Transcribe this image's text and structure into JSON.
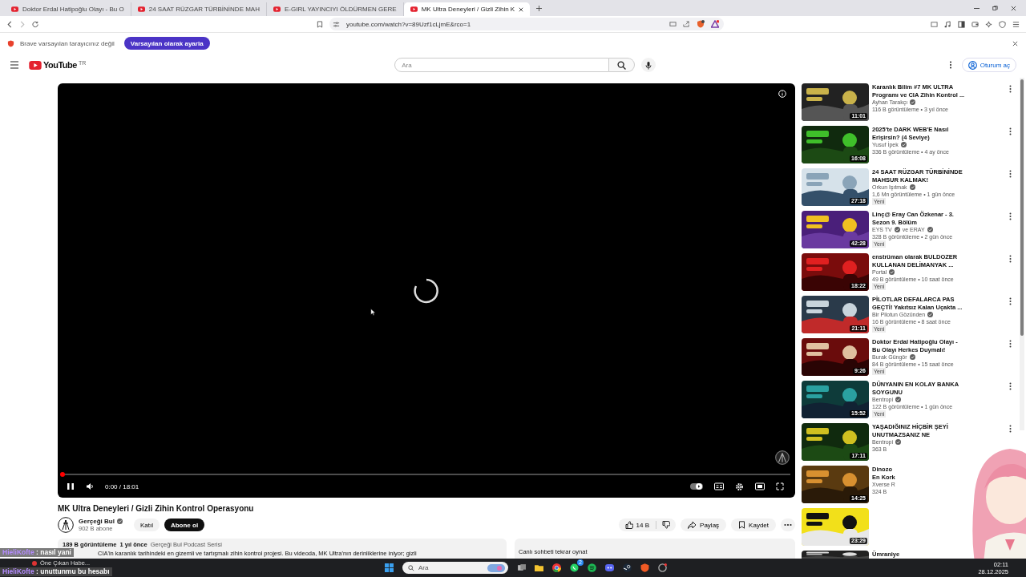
{
  "browser": {
    "tabs": [
      {
        "title": "Doktor Erdal Hatipoğlu Olayı - Bu O",
        "selected": false
      },
      {
        "title": "24 SAAT RÜZGAR TÜRBİNİNDE MAH",
        "selected": false
      },
      {
        "title": "E-GIRL YAYINCIYI ÖLDÜRMEN GERE",
        "selected": false
      },
      {
        "title": "MK Ultra Deneyleri / Gizli Zihin K",
        "selected": true
      }
    ],
    "address": "youtube.com/watch?v=89Uzf1cLjmE&rco=1",
    "infobar": {
      "text": "Brave varsayılan tarayıcınız değil",
      "button": "Varsayılan olarak ayarla"
    }
  },
  "header": {
    "logo": "YouTube",
    "region": "TR",
    "search_placeholder": "Ara",
    "sign_in": "Oturum aç"
  },
  "player": {
    "time": "0:00 / 18:01",
    "level": 0,
    "playing": true
  },
  "video": {
    "title": "MK Ultra Deneyleri / Gizli Zihin Kontrol Operasyonu",
    "channel": "Gerçeği Bul",
    "subscribers": "902 B abone",
    "join": "Katıl",
    "subscribe": "Abone ol",
    "likes": "14 B",
    "share": "Paylaş",
    "save": "Kaydet",
    "views": "189 B görüntüleme",
    "age": "1 yıl önce",
    "playlist": "Gerçeği Bul Podcast Serisi",
    "description": "CIA'in karanlık tarihindeki en gizemli ve tartışmalı zihin kontrol projesi. Bu videoda, MK Ultra'nın derinliklerine iniyor; gizli"
  },
  "chat_replay": {
    "title": "Canlı sohbeti tekrar oynat"
  },
  "recommendations": [
    {
      "title": "Karanlık Bilim #7 MK ULTRA\nProgramı ve CIA Zihin Kontrol ...",
      "channel": "Ayhan Tarakçı",
      "verified": true,
      "meta": "116 B görüntüleme • 3 yıl önce",
      "duration": "11:01"
    },
    {
      "title": "2025'te DARK WEB'E Nasıl\nErişirsin? (4 Seviye)",
      "channel": "Yusuf İpek",
      "verified": true,
      "meta": "336 B görüntüleme • 4 ay önce",
      "duration": "16:08"
    },
    {
      "title": "24 SAAT RÜZGAR TÜRBİNİNDE\nMAHSUR KALMAK!",
      "channel": "Orkun Işıtmak",
      "verified": true,
      "meta": "1,6 Mn görüntüleme • 1 gün önce",
      "duration": "27:18",
      "badge": "Yeni"
    },
    {
      "title": "Linç@ Eray Can Özkenar - 3.\nSezon 9. Bölüm",
      "channel": "EYS TV",
      "verified": true,
      "co_channel": "ve ERAY",
      "meta": "328 B görüntüleme • 2 gün önce",
      "duration": "42:28",
      "badge": "Yeni"
    },
    {
      "title": "enstrüman olarak BULDOZER\nKULLANAN DELİMANYAK ...",
      "channel": "Portal",
      "verified": true,
      "meta": "49 B görüntüleme • 10 saat önce",
      "duration": "18:22",
      "badge": "Yeni"
    },
    {
      "title": "PİLOTLAR DEFALARCA PAS\nGEÇTİ! Yakıtsız Kalan Uçakta ...",
      "channel": "Bir Pilotun Gözünden",
      "verified": true,
      "meta": "16 B görüntüleme • 8 saat önce",
      "duration": "21:11",
      "badge": "Yeni"
    },
    {
      "title": "Doktor Erdal Hatipoğlu Olayı -\nBu Olayı Herkes Duymalı!",
      "channel": "Burak Güngör",
      "verified": true,
      "meta": "84 B görüntüleme • 15 saat önce",
      "duration": "9:26",
      "badge": "Yeni"
    },
    {
      "title": "DÜNYANIN EN KOLAY BANKA\nSOYGUNU",
      "channel": "Bentropi",
      "verified": true,
      "meta": "122 B görüntüleme • 1 gün önce",
      "duration": "15:52",
      "badge": "Yeni"
    },
    {
      "title": "YAŞADIĞINIZ HİÇBİR ŞEYİ\nUNUTMAZSANIZ NE",
      "channel": "Bentropi",
      "verified": true,
      "meta": "363 B",
      "duration": "17:11"
    },
    {
      "title": "Dinozo\nEn Kork",
      "channel": "Xverse R",
      "meta": "324 B",
      "duration": "14:25"
    },
    {
      "duration": "23:29"
    },
    {
      "title": "Ümraniye"
    }
  ],
  "chat_overlay": [
    {
      "user": "HieliKofte",
      "message": ": nasıl yani"
    },
    {
      "user": "HieliKofte",
      "message": ": unuttunmu bu hesabı"
    }
  ],
  "taskbar": {
    "news": "Öne Çıkan Habe...",
    "search_placeholder": "Ara",
    "badges": {
      "whatsapp": "2"
    },
    "time": "02:11",
    "date": "28.12.2025"
  }
}
